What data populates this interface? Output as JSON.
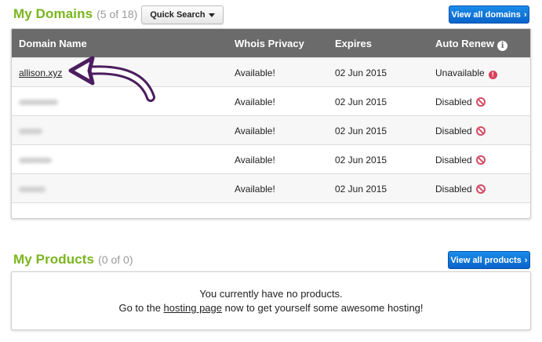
{
  "domains_section": {
    "title": "My Domains",
    "count": "(5 of 18)",
    "quick_search_label": "Quick Search",
    "view_all_label": "View all domains",
    "columns": {
      "domain": "Domain Name",
      "whois": "Whois Privacy",
      "expires": "Expires",
      "auto_renew": "Auto Renew"
    },
    "rows": [
      {
        "domain": "allison.xyz",
        "whois": "Available!",
        "expires": "02 Jun 2015",
        "auto_renew": "Unavailable",
        "status_icon": "alert-icon"
      },
      {
        "domain": "",
        "whois": "Available!",
        "expires": "02 Jun 2015",
        "auto_renew": "Disabled",
        "status_icon": "disabled-icon"
      },
      {
        "domain": "",
        "whois": "Available!",
        "expires": "02 Jun 2015",
        "auto_renew": "Disabled",
        "status_icon": "disabled-icon"
      },
      {
        "domain": "",
        "whois": "Available!",
        "expires": "02 Jun 2015",
        "auto_renew": "Disabled",
        "status_icon": "disabled-icon"
      },
      {
        "domain": "",
        "whois": "Available!",
        "expires": "02 Jun 2015",
        "auto_renew": "Disabled",
        "status_icon": "disabled-icon"
      }
    ]
  },
  "products_section": {
    "title": "My Products",
    "count": "(0 of 0)",
    "view_all_label": "View all products",
    "empty_line1": "You currently have no products.",
    "empty_line2_before": "Go to the ",
    "empty_line2_link": "hosting page",
    "empty_line2_after": " now to get yourself some awesome hosting!"
  },
  "colors": {
    "title_green": "#7ab51d",
    "header_gray": "#6b6b6b",
    "button_blue": "#0a63c9",
    "status_red": "#d24d66",
    "arrow_purple": "#4b1d5e"
  }
}
